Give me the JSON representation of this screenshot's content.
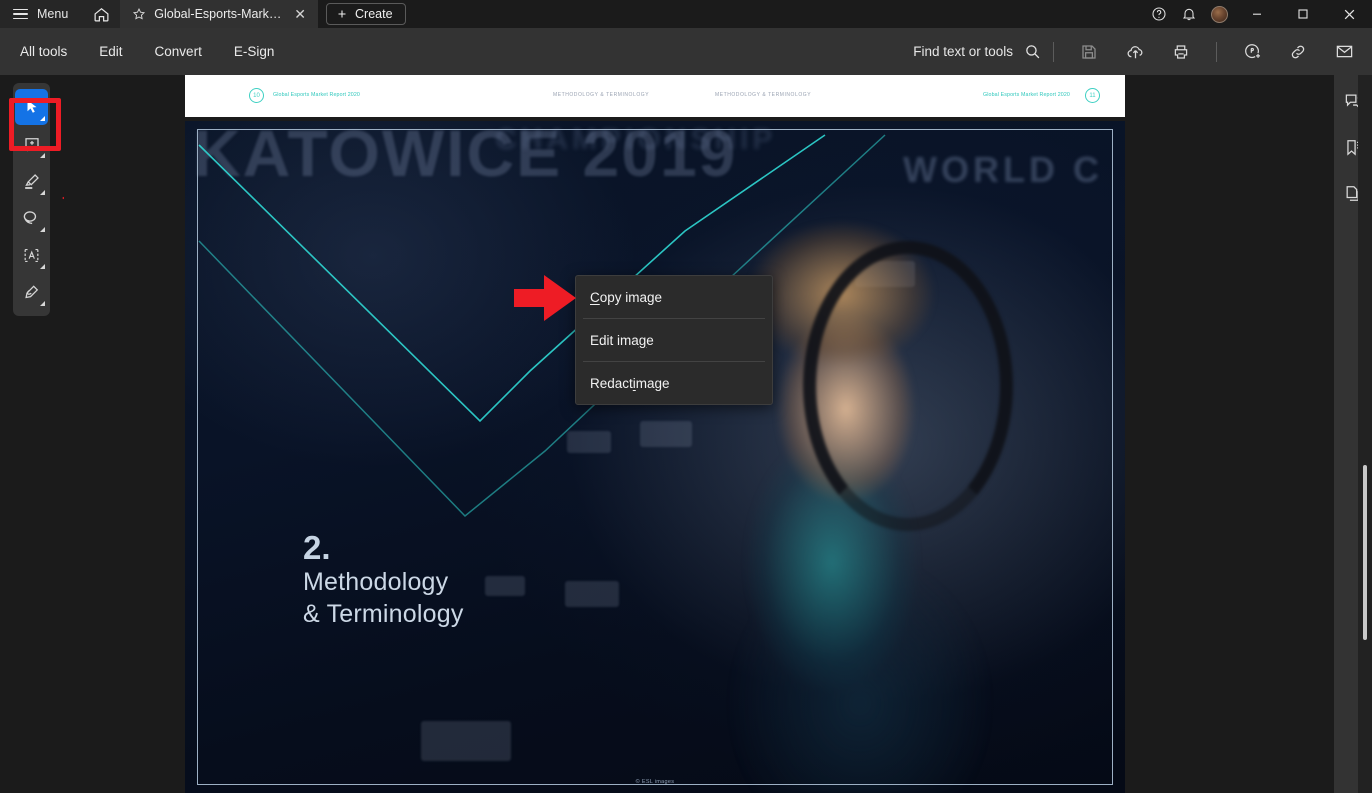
{
  "titlebar": {
    "menu_label": "Menu",
    "home_icon": "home-icon",
    "tab": {
      "favorite_icon": "star-icon",
      "title": "Global-Esports-Market-…",
      "close_icon": "close-icon"
    },
    "create_label": "Create",
    "help_icon": "help-circle-icon",
    "notifications_icon": "bell-icon",
    "avatar_icon": "user-avatar",
    "minimize_icon": "minimize-icon",
    "maximize_icon": "maximize-icon",
    "close_icon": "window-close-icon"
  },
  "menubar": {
    "items": [
      {
        "label": "All tools"
      },
      {
        "label": "Edit"
      },
      {
        "label": "Convert"
      },
      {
        "label": "E-Sign"
      }
    ],
    "find_label": "Find text or tools",
    "find_icon": "search-icon",
    "actions": [
      {
        "name": "save-icon"
      },
      {
        "name": "cloud-upload-icon"
      },
      {
        "name": "print-icon"
      },
      {
        "name": "add-comment-icon"
      },
      {
        "name": "link-icon"
      },
      {
        "name": "mail-icon"
      }
    ]
  },
  "left_rail": {
    "tools": [
      {
        "name": "select-tool",
        "icon": "cursor-arrow-icon",
        "active": true
      },
      {
        "name": "comment-tool",
        "icon": "add-comment-icon",
        "active": false
      },
      {
        "name": "highlight-tool",
        "icon": "highlighter-icon",
        "active": false
      },
      {
        "name": "lasso-tool",
        "icon": "lasso-icon",
        "active": false
      },
      {
        "name": "text-select-tool",
        "icon": "select-text-icon",
        "active": false
      },
      {
        "name": "draw-tool",
        "icon": "pen-draw-icon",
        "active": false
      }
    ],
    "highlight_color": "#ee1c25"
  },
  "right_rail": {
    "items": [
      {
        "name": "comments-panel-icon"
      },
      {
        "name": "bookmarks-panel-icon"
      },
      {
        "name": "page-thumbnails-icon"
      }
    ]
  },
  "context_menu": {
    "items": [
      {
        "label": "Copy image",
        "mnemonic_index": 0
      },
      {
        "label": "Edit image",
        "mnemonic_index": 7
      },
      {
        "label": "Redact image",
        "mnemonic_index": 7
      }
    ]
  },
  "document": {
    "header": {
      "left_badge": "10",
      "left_text": "Global Esports Market Report 2020",
      "center_text_1": "METHODOLOGY & TERMINOLOGY",
      "center_text_2": "METHODOLOGY & TERMINOLOGY",
      "right_text": "Global Esports Market Report 2020",
      "right_badge": "11"
    },
    "page": {
      "section_number": "2.",
      "title_line_1": "Methodology",
      "title_line_2": "& Terminology",
      "background_text_1": "KATOWICE 2019",
      "background_text_2": "CHAMPIONSHIP",
      "background_text_3": "WORLD C",
      "credit": "© ESL images",
      "accent_color": "#3fd0c3",
      "title_color": "#ccd8e6"
    }
  },
  "scrollbar": {
    "orientation": "vertical"
  }
}
